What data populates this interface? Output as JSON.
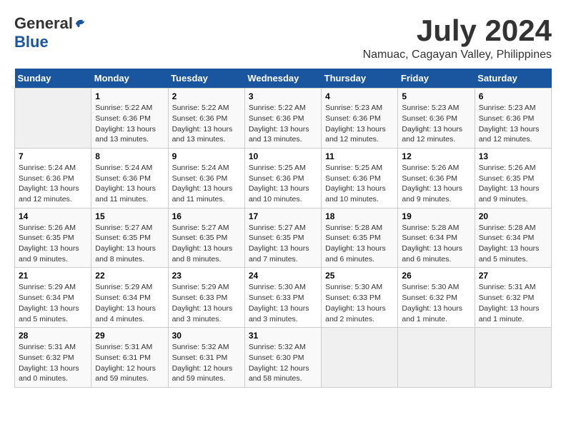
{
  "logo": {
    "general": "General",
    "blue": "Blue"
  },
  "title": {
    "month_year": "July 2024",
    "location": "Namuac, Cagayan Valley, Philippines"
  },
  "calendar": {
    "days_of_week": [
      "Sunday",
      "Monday",
      "Tuesday",
      "Wednesday",
      "Thursday",
      "Friday",
      "Saturday"
    ],
    "weeks": [
      [
        {
          "day": "",
          "info": ""
        },
        {
          "day": "1",
          "info": "Sunrise: 5:22 AM\nSunset: 6:36 PM\nDaylight: 13 hours\nand 13 minutes."
        },
        {
          "day": "2",
          "info": "Sunrise: 5:22 AM\nSunset: 6:36 PM\nDaylight: 13 hours\nand 13 minutes."
        },
        {
          "day": "3",
          "info": "Sunrise: 5:22 AM\nSunset: 6:36 PM\nDaylight: 13 hours\nand 13 minutes."
        },
        {
          "day": "4",
          "info": "Sunrise: 5:23 AM\nSunset: 6:36 PM\nDaylight: 13 hours\nand 12 minutes."
        },
        {
          "day": "5",
          "info": "Sunrise: 5:23 AM\nSunset: 6:36 PM\nDaylight: 13 hours\nand 12 minutes."
        },
        {
          "day": "6",
          "info": "Sunrise: 5:23 AM\nSunset: 6:36 PM\nDaylight: 13 hours\nand 12 minutes."
        }
      ],
      [
        {
          "day": "7",
          "info": "Sunrise: 5:24 AM\nSunset: 6:36 PM\nDaylight: 13 hours\nand 12 minutes."
        },
        {
          "day": "8",
          "info": "Sunrise: 5:24 AM\nSunset: 6:36 PM\nDaylight: 13 hours\nand 11 minutes."
        },
        {
          "day": "9",
          "info": "Sunrise: 5:24 AM\nSunset: 6:36 PM\nDaylight: 13 hours\nand 11 minutes."
        },
        {
          "day": "10",
          "info": "Sunrise: 5:25 AM\nSunset: 6:36 PM\nDaylight: 13 hours\nand 10 minutes."
        },
        {
          "day": "11",
          "info": "Sunrise: 5:25 AM\nSunset: 6:36 PM\nDaylight: 13 hours\nand 10 minutes."
        },
        {
          "day": "12",
          "info": "Sunrise: 5:26 AM\nSunset: 6:36 PM\nDaylight: 13 hours\nand 9 minutes."
        },
        {
          "day": "13",
          "info": "Sunrise: 5:26 AM\nSunset: 6:35 PM\nDaylight: 13 hours\nand 9 minutes."
        }
      ],
      [
        {
          "day": "14",
          "info": "Sunrise: 5:26 AM\nSunset: 6:35 PM\nDaylight: 13 hours\nand 9 minutes."
        },
        {
          "day": "15",
          "info": "Sunrise: 5:27 AM\nSunset: 6:35 PM\nDaylight: 13 hours\nand 8 minutes."
        },
        {
          "day": "16",
          "info": "Sunrise: 5:27 AM\nSunset: 6:35 PM\nDaylight: 13 hours\nand 8 minutes."
        },
        {
          "day": "17",
          "info": "Sunrise: 5:27 AM\nSunset: 6:35 PM\nDaylight: 13 hours\nand 7 minutes."
        },
        {
          "day": "18",
          "info": "Sunrise: 5:28 AM\nSunset: 6:35 PM\nDaylight: 13 hours\nand 6 minutes."
        },
        {
          "day": "19",
          "info": "Sunrise: 5:28 AM\nSunset: 6:34 PM\nDaylight: 13 hours\nand 6 minutes."
        },
        {
          "day": "20",
          "info": "Sunrise: 5:28 AM\nSunset: 6:34 PM\nDaylight: 13 hours\nand 5 minutes."
        }
      ],
      [
        {
          "day": "21",
          "info": "Sunrise: 5:29 AM\nSunset: 6:34 PM\nDaylight: 13 hours\nand 5 minutes."
        },
        {
          "day": "22",
          "info": "Sunrise: 5:29 AM\nSunset: 6:34 PM\nDaylight: 13 hours\nand 4 minutes."
        },
        {
          "day": "23",
          "info": "Sunrise: 5:29 AM\nSunset: 6:33 PM\nDaylight: 13 hours\nand 3 minutes."
        },
        {
          "day": "24",
          "info": "Sunrise: 5:30 AM\nSunset: 6:33 PM\nDaylight: 13 hours\nand 3 minutes."
        },
        {
          "day": "25",
          "info": "Sunrise: 5:30 AM\nSunset: 6:33 PM\nDaylight: 13 hours\nand 2 minutes."
        },
        {
          "day": "26",
          "info": "Sunrise: 5:30 AM\nSunset: 6:32 PM\nDaylight: 13 hours\nand 1 minute."
        },
        {
          "day": "27",
          "info": "Sunrise: 5:31 AM\nSunset: 6:32 PM\nDaylight: 13 hours\nand 1 minute."
        }
      ],
      [
        {
          "day": "28",
          "info": "Sunrise: 5:31 AM\nSunset: 6:32 PM\nDaylight: 13 hours\nand 0 minutes."
        },
        {
          "day": "29",
          "info": "Sunrise: 5:31 AM\nSunset: 6:31 PM\nDaylight: 12 hours\nand 59 minutes."
        },
        {
          "day": "30",
          "info": "Sunrise: 5:32 AM\nSunset: 6:31 PM\nDaylight: 12 hours\nand 59 minutes."
        },
        {
          "day": "31",
          "info": "Sunrise: 5:32 AM\nSunset: 6:30 PM\nDaylight: 12 hours\nand 58 minutes."
        },
        {
          "day": "",
          "info": ""
        },
        {
          "day": "",
          "info": ""
        },
        {
          "day": "",
          "info": ""
        }
      ]
    ]
  }
}
